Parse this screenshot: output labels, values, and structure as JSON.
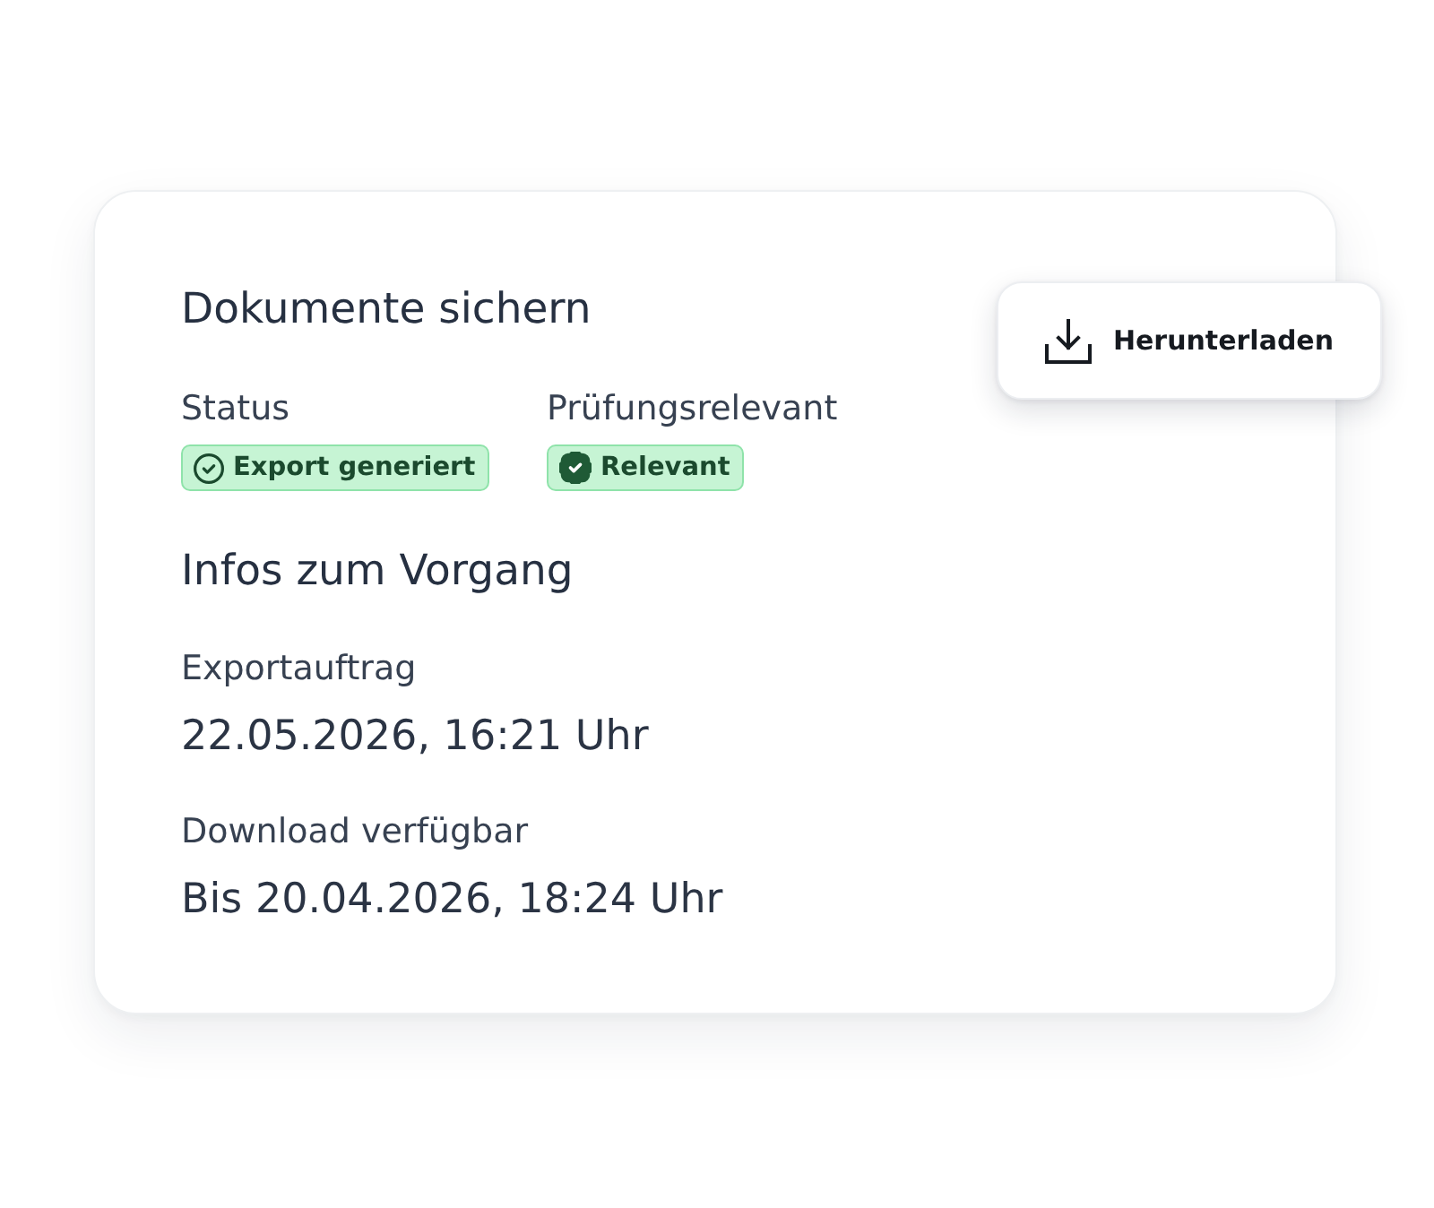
{
  "card": {
    "title": "Dokumente sichern",
    "download_button": {
      "label": "Herunterladen"
    },
    "fields": [
      {
        "label": "Status",
        "badge": {
          "kind": "check-circle",
          "label": "Export generiert"
        }
      },
      {
        "label": "Prüfungsrelevant",
        "badge": {
          "kind": "verified",
          "label": "Relevant"
        }
      }
    ]
  },
  "section": {
    "title": "Infos zum Vorgang",
    "items": [
      {
        "label": "Exportauftrag",
        "value": "22.05.2026, 16:21 Uhr"
      },
      {
        "label": "Download verfügbar",
        "value": "Bis 20.04.2026, 18:24 Uhr"
      }
    ]
  }
}
